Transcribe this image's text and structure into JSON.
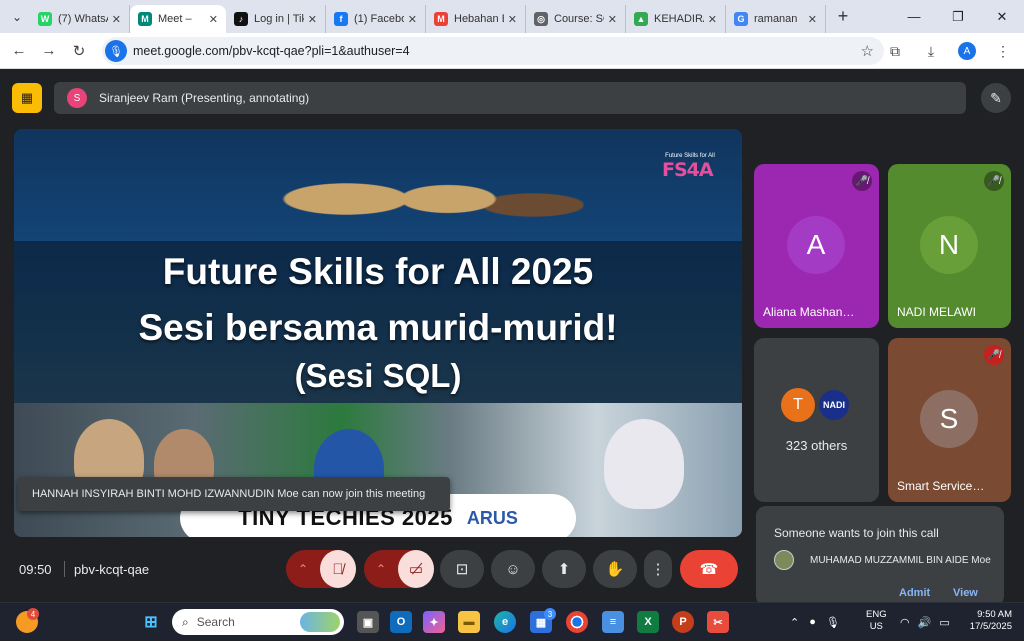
{
  "browser": {
    "tabs": [
      {
        "label": "(7) WhatsA",
        "icon": "whatsapp-icon",
        "color": "#25d366",
        "glyph": "W"
      },
      {
        "label": "Meet –",
        "icon": "meet-icon",
        "color": "#00897b",
        "glyph": "M",
        "active": true
      },
      {
        "label": "Log in | Tik",
        "icon": "tiktok-icon",
        "color": "#111111",
        "glyph": "♪"
      },
      {
        "label": "(1) Facebo",
        "icon": "facebook-icon",
        "color": "#1877f2",
        "glyph": "f"
      },
      {
        "label": "Hebahan E",
        "icon": "gmail-icon",
        "color": "#ea4335",
        "glyph": "M"
      },
      {
        "label": "Course: SC",
        "icon": "globe-icon",
        "color": "#5f6368",
        "glyph": "◎"
      },
      {
        "label": "KEHADIRA",
        "icon": "drive-icon",
        "color": "#34a853",
        "glyph": "▲"
      },
      {
        "label": "ramanan",
        "icon": "google-icon",
        "color": "#4285f4",
        "glyph": "G"
      }
    ],
    "url": "meet.google.com/pbv-kcqt-qae?pli=1&authuser=4",
    "profile_initial": "A"
  },
  "meet": {
    "presenter_initial": "S",
    "presenter_text": "Siranjeev Ram (Presenting, annotating)",
    "slide": {
      "title_line1": "Future Skills for All 2025",
      "title_line2": "Sesi bersama murid-murid!",
      "title_line3": "(Sesi SQL)",
      "logo_text": "FS4A",
      "logo_subtext": "Future Skills for All",
      "banner_text": "TINY TECHIES 2025",
      "banner_suffix": "ARUS"
    },
    "toast": "HANNAH INSYIRAH BINTI MOHD IZWANNUDIN Moe can now join this meeting",
    "participants": [
      {
        "initial": "A",
        "name": "Aliana Mashan…",
        "tile_color": "#9c27b0",
        "avatar_color": "#a43bc4",
        "muted": true
      },
      {
        "initial": "N",
        "name": "NADI MELAWI",
        "tile_color": "#558b2f",
        "avatar_color": "#689f38",
        "muted": true
      },
      {
        "initial": "S",
        "name": "Smart Service…",
        "tile_color": "#7a4a33",
        "avatar_color": "#8d6e63",
        "muted": true
      }
    ],
    "others": {
      "count_label": "323 others",
      "initial1": "T",
      "initial2": "NADI"
    },
    "join_request": {
      "title": "Someone wants to join this call",
      "name": "MUHAMAD MUZZAMMIL BIN AIDE Moe",
      "admit": "Admit",
      "view": "View"
    },
    "time": "09:50",
    "meeting_code": "pbv-kcqt-qae"
  },
  "taskbar": {
    "search_placeholder": "Search",
    "weather_badge": "4",
    "store_badge": "3",
    "lang_top": "ENG",
    "lang_bottom": "US",
    "time": "9:50 AM",
    "date": "17/5/2025"
  }
}
